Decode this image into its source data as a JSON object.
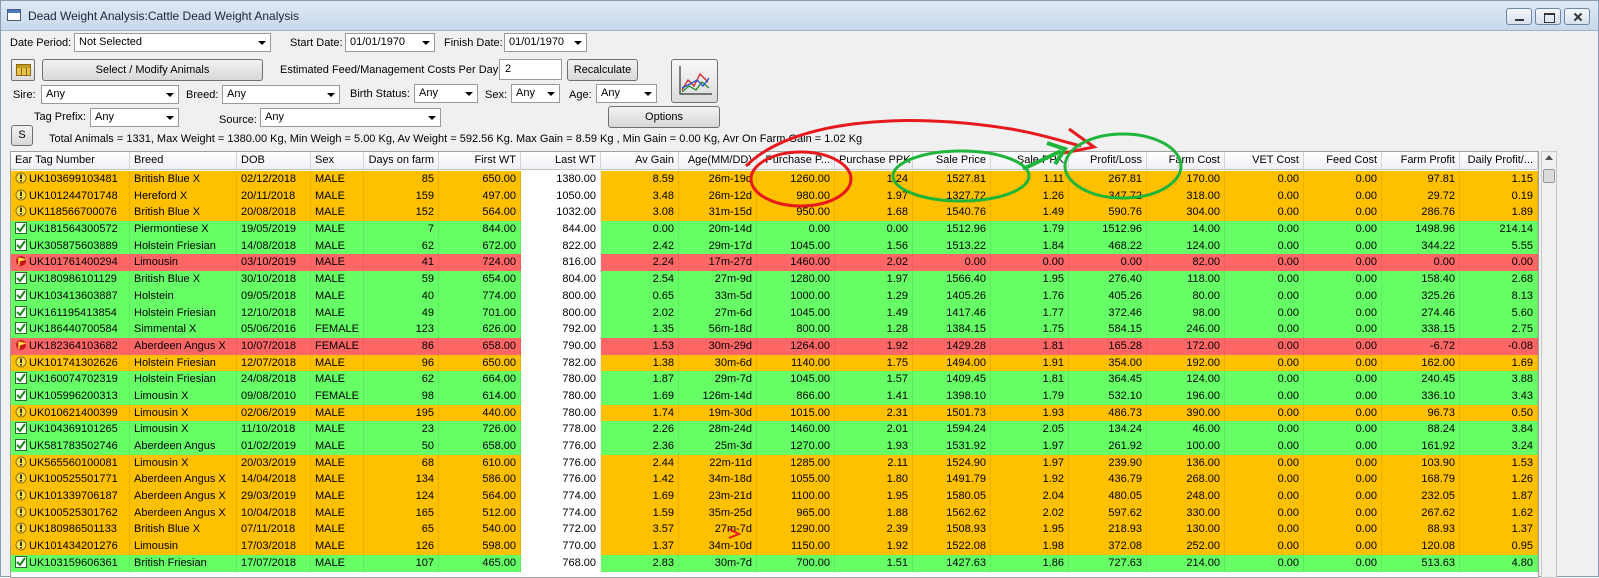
{
  "window": {
    "title": "Dead Weight Analysis:Cattle Dead Weight Analysis"
  },
  "filters": {
    "date_period_label": "Date Period:",
    "date_period_value": "Not Selected",
    "start_date_label": "Start Date:",
    "start_date_value": "01/01/1970",
    "finish_date_label": "Finish Date:",
    "finish_date_value": "01/01/1970",
    "select_modify_label": "Select / Modify Animals",
    "feed_cost_label": "Estimated Feed/Management Costs Per Day:",
    "feed_cost_value": "2",
    "recalculate_label": "Recalculate",
    "sire_label": "Sire:",
    "sire_value": "Any",
    "breed_label": "Breed:",
    "breed_value": "Any",
    "birth_status_label": "Birth Status:",
    "birth_status_value": "Any",
    "sex_label": "Sex:",
    "sex_value": "Any",
    "age_label": "Age:",
    "age_value": "Any",
    "tag_prefix_label": "Tag Prefix:",
    "tag_prefix_value": "Any",
    "source_label": "Source:",
    "source_value": "Any",
    "options_label": "Options",
    "s_button_label": "S"
  },
  "stats_text": "Total Animals = 1331, Max Weight = 1380.00 Kg, Min Weigh = 5.00 Kg, Av Weight = 592.56 Kg. Max Gain = 8.59 Kg , Min Gain = 0.00 Kg, Avr On Farm Gain = 1.02 Kg",
  "colors": {
    "orange": "#ffc000",
    "green": "#66ff66",
    "red": "#ff6666",
    "annotation_red": "#e8191d",
    "annotation_green": "#1fb43a"
  },
  "table": {
    "headers": [
      "Ear Tag Number",
      "Breed",
      "DOB",
      "Sex",
      "Days on farm",
      "First WT",
      "Last WT",
      "Av Gain",
      "Age(MM/DD)",
      "Purchase P...",
      "Purchase PPK",
      "Sale Price",
      "Sale PPK",
      "Profit/Loss",
      "Farm Cost",
      "VET Cost",
      "Feed Cost",
      "Farm Profit",
      "Daily Profit/..."
    ],
    "rows": [
      {
        "status": "orange",
        "icon": "warn",
        "cells": [
          "UK103699103481",
          "British Blue X",
          "02/12/2018",
          "MALE",
          "85",
          "650.00",
          "1380.00",
          "8.59",
          "26m-19d",
          "1260.00",
          "1.24",
          "1527.81",
          "1.11",
          "267.81",
          "170.00",
          "0.00",
          "0.00",
          "97.81",
          "1.15"
        ]
      },
      {
        "status": "orange",
        "icon": "warn",
        "cells": [
          "UK101244701748",
          "Hereford X",
          "20/11/2018",
          "MALE",
          "159",
          "497.00",
          "1050.00",
          "3.48",
          "26m-12d",
          "980.00",
          "1.97",
          "1327.72",
          "1.26",
          "347.72",
          "318.00",
          "0.00",
          "0.00",
          "29.72",
          "0.19"
        ]
      },
      {
        "status": "orange",
        "icon": "warn",
        "cells": [
          "UK118566700076",
          "British Blue X",
          "20/08/2018",
          "MALE",
          "152",
          "564.00",
          "1032.00",
          "3.08",
          "31m-15d",
          "950.00",
          "1.68",
          "1540.76",
          "1.49",
          "590.76",
          "304.00",
          "0.00",
          "0.00",
          "286.76",
          "1.89"
        ]
      },
      {
        "status": "green",
        "icon": "check",
        "cells": [
          "UK181564300572",
          "Piermontiese X",
          "19/05/2019",
          "MALE",
          "7",
          "844.00",
          "844.00",
          "0.00",
          "20m-14d",
          "0.00",
          "0.00",
          "1512.96",
          "1.79",
          "1512.96",
          "14.00",
          "0.00",
          "0.00",
          "1498.96",
          "214.14"
        ]
      },
      {
        "status": "green",
        "icon": "check",
        "cells": [
          "UK305875603889",
          "Holstein Friesian",
          "14/08/2018",
          "MALE",
          "62",
          "672.00",
          "822.00",
          "2.42",
          "29m-17d",
          "1045.00",
          "1.56",
          "1513.22",
          "1.84",
          "468.22",
          "124.00",
          "0.00",
          "0.00",
          "344.22",
          "5.55"
        ]
      },
      {
        "status": "red",
        "icon": "flag",
        "cells": [
          "UK101761400294",
          "Limousin",
          "03/10/2019",
          "MALE",
          "41",
          "724.00",
          "816.00",
          "2.24",
          "17m-27d",
          "1460.00",
          "2.02",
          "0.00",
          "0.00",
          "0.00",
          "82.00",
          "0.00",
          "0.00",
          "0.00",
          "0.00"
        ]
      },
      {
        "status": "green",
        "icon": "check",
        "cells": [
          "UK180986101129",
          "British Blue X",
          "30/10/2018",
          "MALE",
          "59",
          "654.00",
          "804.00",
          "2.54",
          "27m-9d",
          "1280.00",
          "1.97",
          "1566.40",
          "1.95",
          "276.40",
          "118.00",
          "0.00",
          "0.00",
          "158.40",
          "2.68"
        ]
      },
      {
        "status": "green",
        "icon": "check",
        "cells": [
          "UK103413603887",
          "Holstein",
          "09/05/2018",
          "MALE",
          "40",
          "774.00",
          "800.00",
          "0.65",
          "33m-5d",
          "1000.00",
          "1.29",
          "1405.26",
          "1.76",
          "405.26",
          "80.00",
          "0.00",
          "0.00",
          "325.26",
          "8.13"
        ]
      },
      {
        "status": "green",
        "icon": "check",
        "cells": [
          "UK161195413854",
          "Holstein Friesian",
          "12/10/2018",
          "MALE",
          "49",
          "701.00",
          "800.00",
          "2.02",
          "27m-6d",
          "1045.00",
          "1.49",
          "1417.46",
          "1.77",
          "372.46",
          "98.00",
          "0.00",
          "0.00",
          "274.46",
          "5.60"
        ]
      },
      {
        "status": "green",
        "icon": "check",
        "cells": [
          "UK186440700584",
          "Simmental X",
          "05/06/2016",
          "FEMALE",
          "123",
          "626.00",
          "792.00",
          "1.35",
          "56m-18d",
          "800.00",
          "1.28",
          "1384.15",
          "1.75",
          "584.15",
          "246.00",
          "0.00",
          "0.00",
          "338.15",
          "2.75"
        ]
      },
      {
        "status": "red",
        "icon": "flag",
        "cells": [
          "UK182364103682",
          "Aberdeen Angus X",
          "10/07/2018",
          "FEMALE",
          "86",
          "658.00",
          "790.00",
          "1.53",
          "30m-29d",
          "1264.00",
          "1.92",
          "1429.28",
          "1.81",
          "165.28",
          "172.00",
          "0.00",
          "0.00",
          "-6.72",
          "-0.08"
        ]
      },
      {
        "status": "orange",
        "icon": "warn",
        "cells": [
          "UK101741302626",
          "Holstein Friesian",
          "12/07/2018",
          "MALE",
          "96",
          "650.00",
          "782.00",
          "1.38",
          "30m-6d",
          "1140.00",
          "1.75",
          "1494.00",
          "1.91",
          "354.00",
          "192.00",
          "0.00",
          "0.00",
          "162.00",
          "1.69"
        ]
      },
      {
        "status": "green",
        "icon": "check",
        "cells": [
          "UK160074702319",
          "Holstein Friesian",
          "24/08/2018",
          "MALE",
          "62",
          "664.00",
          "780.00",
          "1.87",
          "29m-7d",
          "1045.00",
          "1.57",
          "1409.45",
          "1.81",
          "364.45",
          "124.00",
          "0.00",
          "0.00",
          "240.45",
          "3.88"
        ]
      },
      {
        "status": "green",
        "icon": "check",
        "cells": [
          "UK105996200313",
          "Limousin X",
          "09/08/2010",
          "FEMALE",
          "98",
          "614.00",
          "780.00",
          "1.69",
          "126m-14d",
          "866.00",
          "1.41",
          "1398.10",
          "1.79",
          "532.10",
          "196.00",
          "0.00",
          "0.00",
          "336.10",
          "3.43"
        ]
      },
      {
        "status": "orange",
        "icon": "warn",
        "cells": [
          "UK010621400399",
          "Limousin X",
          "02/06/2019",
          "MALE",
          "195",
          "440.00",
          "780.00",
          "1.74",
          "19m-30d",
          "1015.00",
          "2.31",
          "1501.73",
          "1.93",
          "486.73",
          "390.00",
          "0.00",
          "0.00",
          "96.73",
          "0.50"
        ]
      },
      {
        "status": "green",
        "icon": "check",
        "cells": [
          "UK104369101265",
          "Limousin X",
          "11/10/2018",
          "MALE",
          "23",
          "726.00",
          "778.00",
          "2.26",
          "28m-24d",
          "1460.00",
          "2.01",
          "1594.24",
          "2.05",
          "134.24",
          "46.00",
          "0.00",
          "0.00",
          "88.24",
          "3.84"
        ]
      },
      {
        "status": "green",
        "icon": "check",
        "cells": [
          "UK581783502746",
          "Aberdeen Angus",
          "01/02/2019",
          "MALE",
          "50",
          "658.00",
          "776.00",
          "2.36",
          "25m-3d",
          "1270.00",
          "1.93",
          "1531.92",
          "1.97",
          "261.92",
          "100.00",
          "0.00",
          "0.00",
          "161.92",
          "3.24"
        ]
      },
      {
        "status": "orange",
        "icon": "warn",
        "cells": [
          "UK565560100081",
          "Limousin X",
          "20/03/2019",
          "MALE",
          "68",
          "610.00",
          "776.00",
          "2.44",
          "22m-11d",
          "1285.00",
          "2.11",
          "1524.90",
          "1.97",
          "239.90",
          "136.00",
          "0.00",
          "0.00",
          "103.90",
          "1.53"
        ]
      },
      {
        "status": "orange",
        "icon": "warn",
        "cells": [
          "UK100525501771",
          "Aberdeen Angus X",
          "14/04/2018",
          "MALE",
          "134",
          "586.00",
          "776.00",
          "1.42",
          "34m-18d",
          "1055.00",
          "1.80",
          "1491.79",
          "1.92",
          "436.79",
          "268.00",
          "0.00",
          "0.00",
          "168.79",
          "1.26"
        ]
      },
      {
        "status": "orange",
        "icon": "warn",
        "cells": [
          "UK101339706187",
          "Aberdeen Angus X",
          "29/03/2019",
          "MALE",
          "124",
          "564.00",
          "774.00",
          "1.69",
          "23m-21d",
          "1100.00",
          "1.95",
          "1580.05",
          "2.04",
          "480.05",
          "248.00",
          "0.00",
          "0.00",
          "232.05",
          "1.87"
        ]
      },
      {
        "status": "orange",
        "icon": "warn",
        "cells": [
          "UK100525301762",
          "Aberdeen Angus X",
          "10/04/2018",
          "MALE",
          "165",
          "512.00",
          "774.00",
          "1.59",
          "35m-25d",
          "965.00",
          "1.88",
          "1562.62",
          "2.02",
          "597.62",
          "330.00",
          "0.00",
          "0.00",
          "267.62",
          "1.62"
        ]
      },
      {
        "status": "orange",
        "icon": "warn",
        "cells": [
          "UK180986501133",
          "British Blue X",
          "07/11/2018",
          "MALE",
          "65",
          "540.00",
          "772.00",
          "3.57",
          "27m-7d",
          "1290.00",
          "2.39",
          "1508.93",
          "1.95",
          "218.93",
          "130.00",
          "0.00",
          "0.00",
          "88.93",
          "1.37"
        ]
      },
      {
        "status": "orange",
        "icon": "warn",
        "cells": [
          "UK101434201276",
          "Limousin",
          "17/03/2018",
          "MALE",
          "126",
          "598.00",
          "770.00",
          "1.37",
          "34m-10d",
          "1150.00",
          "1.92",
          "1522.08",
          "1.98",
          "372.08",
          "252.00",
          "0.00",
          "0.00",
          "120.08",
          "0.95"
        ]
      },
      {
        "status": "green",
        "icon": "check",
        "cells": [
          "UK103159606361",
          "British Friesian",
          "17/07/2018",
          "MALE",
          "107",
          "465.00",
          "768.00",
          "2.83",
          "30m-7d",
          "700.00",
          "1.51",
          "1427.63",
          "1.86",
          "727.63",
          "214.00",
          "0.00",
          "0.00",
          "513.63",
          "4.80"
        ]
      }
    ]
  }
}
